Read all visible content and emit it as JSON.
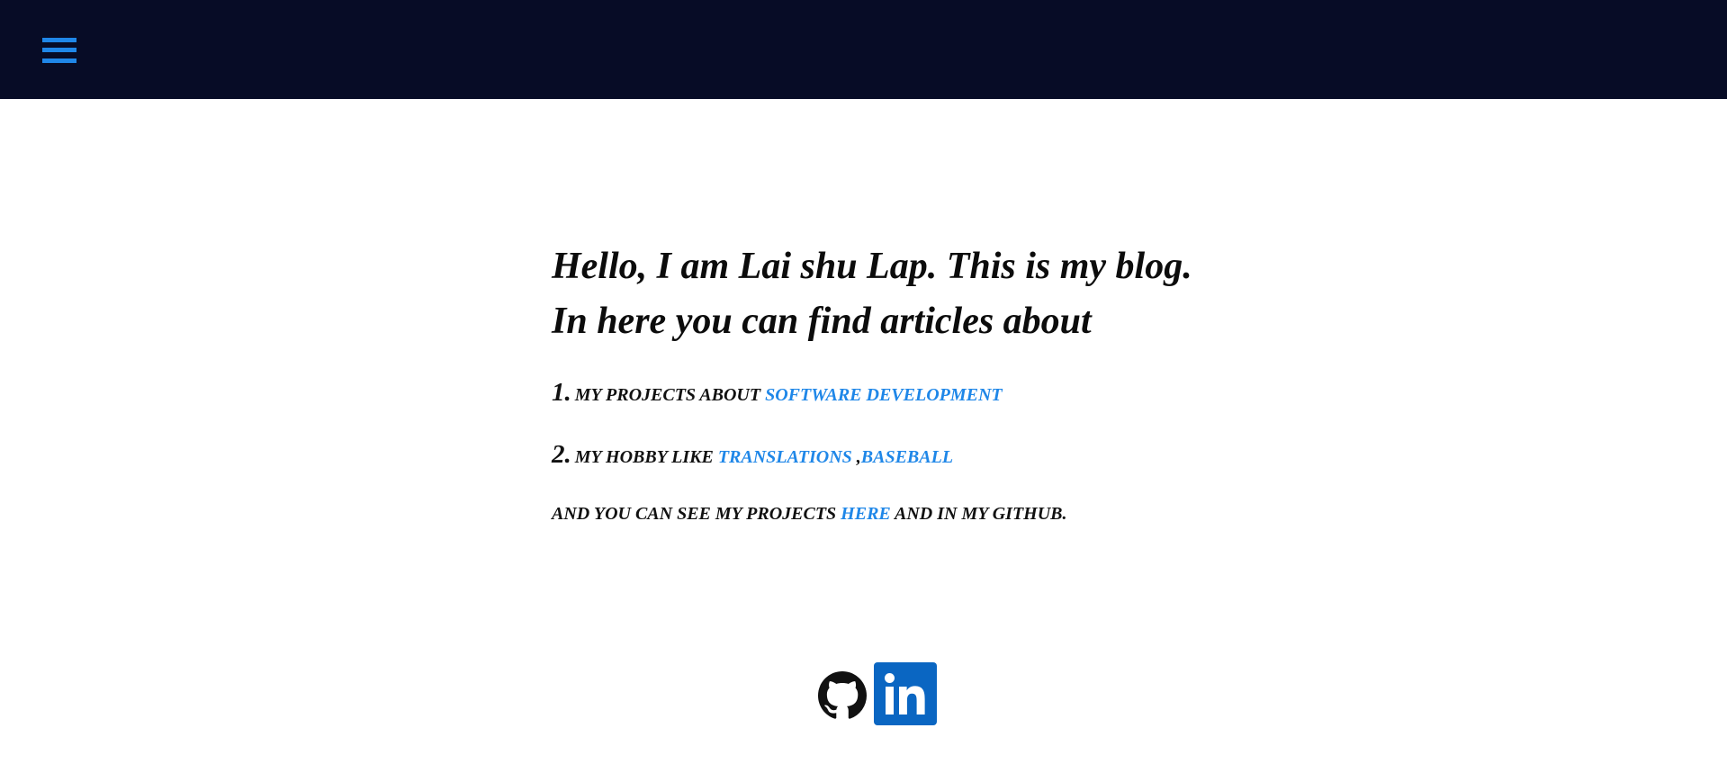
{
  "header": {
    "menu_icon": "hamburger-menu-icon",
    "background": "#070c26",
    "accent": "#1f87e8"
  },
  "intro": {
    "text": "Hello, I am Lai shu Lap. This is my blog. In here you can find articles about"
  },
  "items": [
    {
      "number": "1.",
      "text": "my projects about ",
      "links": [
        {
          "label": "software development"
        }
      ]
    },
    {
      "number": "2.",
      "text": "my hobby like ",
      "links": [
        {
          "label": "Translations "
        },
        {
          "label": "Baseball"
        }
      ],
      "separator": ","
    }
  ],
  "outro": {
    "prefix": "and you can see my projects ",
    "link": "here",
    "suffix": " and in my github."
  },
  "socials": [
    {
      "name": "github",
      "icon": "github-icon"
    },
    {
      "name": "linkedin",
      "icon": "linkedin-icon"
    }
  ]
}
